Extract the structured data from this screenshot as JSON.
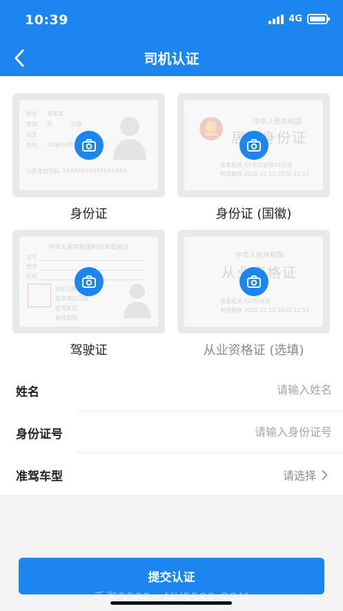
{
  "status_bar": {
    "time": "10:39",
    "network": "4G"
  },
  "nav": {
    "title": "司机认证"
  },
  "cards": [
    {
      "label": "身份证"
    },
    {
      "label": "身份证 (国徽)"
    },
    {
      "label": "驾驶证"
    },
    {
      "label": "从业资格证 (选填)"
    }
  ],
  "sample_text": {
    "id_front": [
      "姓名",
      "性别",
      "出生",
      "住址",
      "公民身份号码",
      "莫某某",
      "男",
      "汉族",
      "XX省XX市XX区",
      "XXXXXXXXXXXXXXXXX"
    ],
    "id_back_header": "中华人民共和国",
    "id_back_title": "居民身份证",
    "id_back_lines": [
      "签发机关  XX市公安局XX分局",
      "有效期限  2020.12.12-2030.12.12"
    ],
    "license_header": "中华人民共和国机动车驾驶证",
    "license_lines": [
      "证号",
      "姓名",
      "住址",
      "出生日期",
      "初次领证日期",
      "准驾车型",
      "有效期限"
    ],
    "qual_header": "中华人民共和国",
    "qual_title": "从业资格证",
    "qual_lines": [
      "签发机关  XX市XX局",
      "有效期限  2020.12.12-2030.12.12"
    ]
  },
  "form": {
    "name": {
      "label": "姓名",
      "placeholder": "请输入姓名"
    },
    "id_number": {
      "label": "身份证号",
      "placeholder": "请输入身份证号"
    },
    "license_type": {
      "label": "准驾车型",
      "value": "请选择"
    }
  },
  "submit": {
    "label": "提交认证"
  },
  "watermark": "手游5588 · MY5588.COM",
  "colors": {
    "primary": "#1b86ee",
    "card_bg": "#e9e9e9",
    "page_bg": "#f3f3f3"
  },
  "icons": [
    "back-arrow-icon",
    "camera-icon",
    "chevron-right-icon",
    "signal-icon",
    "battery-icon"
  ]
}
